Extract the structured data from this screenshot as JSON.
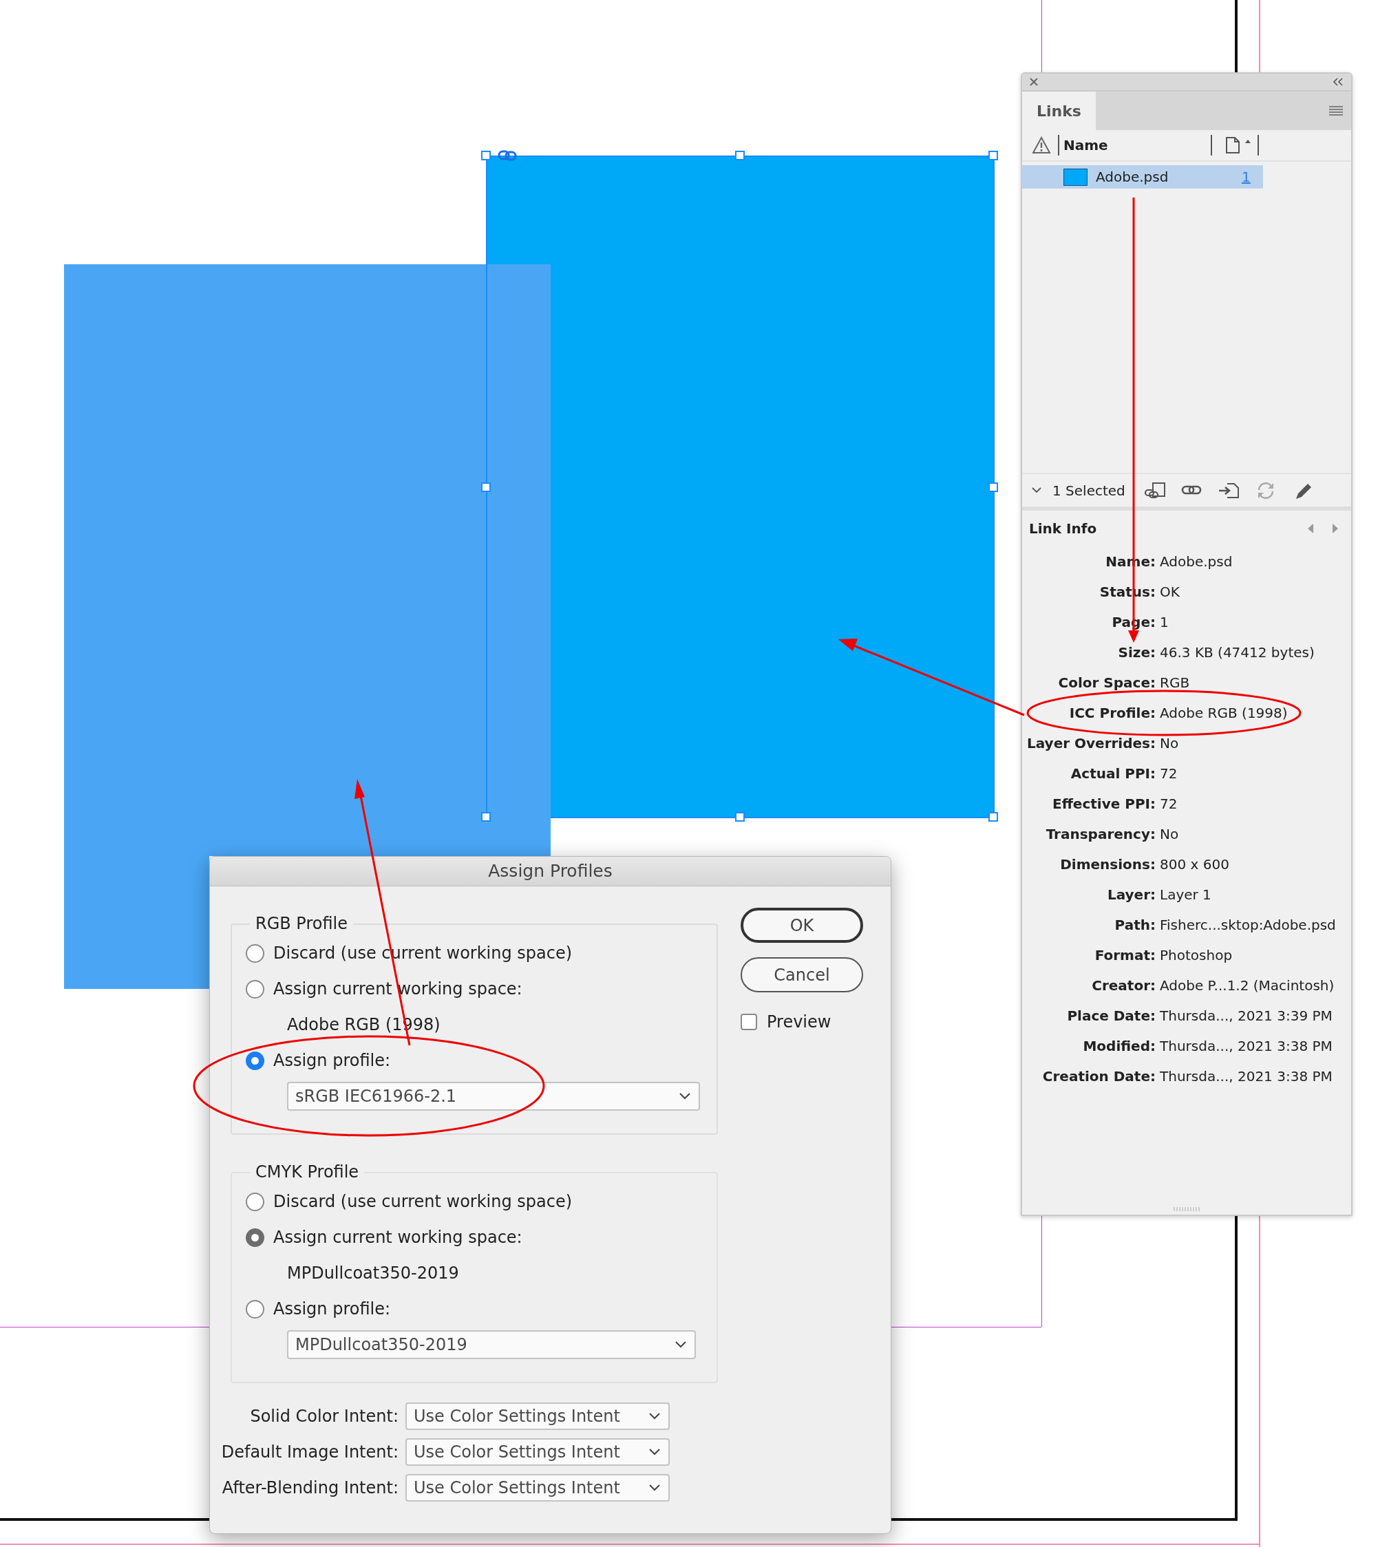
{
  "links_panel": {
    "title": "Links",
    "columns": [
      {
        "label": "Name"
      }
    ],
    "rows": [
      {
        "name": "Adobe.psd",
        "page": "1",
        "selected": true
      }
    ],
    "selection_count": "1 Selected",
    "toolbar": [
      {
        "kind": "relink",
        "disabled": false
      },
      {
        "kind": "link",
        "disabled": false
      },
      {
        "kind": "goto",
        "disabled": false
      },
      {
        "kind": "update",
        "disabled": true
      },
      {
        "kind": "edit",
        "disabled": false
      }
    ],
    "link_info": {
      "title": "Link Info",
      "fields": [
        {
          "label": "Name:",
          "value": "Adobe.psd"
        },
        {
          "label": "Status:",
          "value": "OK"
        },
        {
          "label": "Page:",
          "value": "1"
        },
        {
          "label": "Size:",
          "value": "46.3 KB (47412 bytes)"
        },
        {
          "label": "Color Space:",
          "value": "RGB"
        },
        {
          "label": "ICC Profile:",
          "value": "Adobe RGB (1998)"
        },
        {
          "label": "Layer Overrides:",
          "value": "No"
        },
        {
          "label": "Actual PPI:",
          "value": "72"
        },
        {
          "label": "Effective PPI:",
          "value": "72"
        },
        {
          "label": "Transparency:",
          "value": "No"
        },
        {
          "label": "Dimensions:",
          "value": "800 x 600"
        },
        {
          "label": "Layer:",
          "value": "Layer 1"
        },
        {
          "label": "Path:",
          "value": "Fisherc...sktop:Adobe.psd"
        },
        {
          "label": "Format:",
          "value": "Photoshop"
        },
        {
          "label": "Creator:",
          "value": "Adobe P...1.2 (Macintosh)"
        },
        {
          "label": "Place Date:",
          "value": "Thursda..., 2021 3:39 PM"
        },
        {
          "label": "Modified:",
          "value": "Thursda..., 2021 3:38 PM"
        },
        {
          "label": "Creation Date:",
          "value": "Thursda..., 2021 3:38 PM"
        }
      ]
    }
  },
  "dialog": {
    "title": "Assign Profiles",
    "sections": [
      {
        "title": "RGB Profile",
        "focused": true,
        "options": [
          {
            "label": "Discard (use current working space)",
            "selected": false
          },
          {
            "label": "Assign current working space:",
            "selected": false,
            "detail": "Adobe RGB (1998)"
          },
          {
            "label": "Assign profile:",
            "selected": true,
            "dropdown": "sRGB IEC61966-2.1"
          }
        ]
      },
      {
        "title": "CMYK Profile",
        "focused": false,
        "options": [
          {
            "label": "Discard (use current working space)",
            "selected": false
          },
          {
            "label": "Assign current working space:",
            "selected": true,
            "detail": "MPDullcoat350-2019"
          },
          {
            "label": "Assign profile:",
            "selected": false,
            "dropdown": "MPDullcoat350-2019"
          }
        ]
      }
    ],
    "buttons": [
      {
        "label": "OK",
        "default": true
      },
      {
        "label": "Cancel",
        "default": false
      }
    ],
    "preview": {
      "label": "Preview",
      "checked": false
    },
    "intents": [
      {
        "label": "Solid Color Intent:",
        "value": "Use Color Settings Intent"
      },
      {
        "label": "Default Image Intent:",
        "value": "Use Color Settings Intent"
      },
      {
        "label": "After-Blending Intent:",
        "value": "Use Color Settings Intent"
      }
    ]
  }
}
